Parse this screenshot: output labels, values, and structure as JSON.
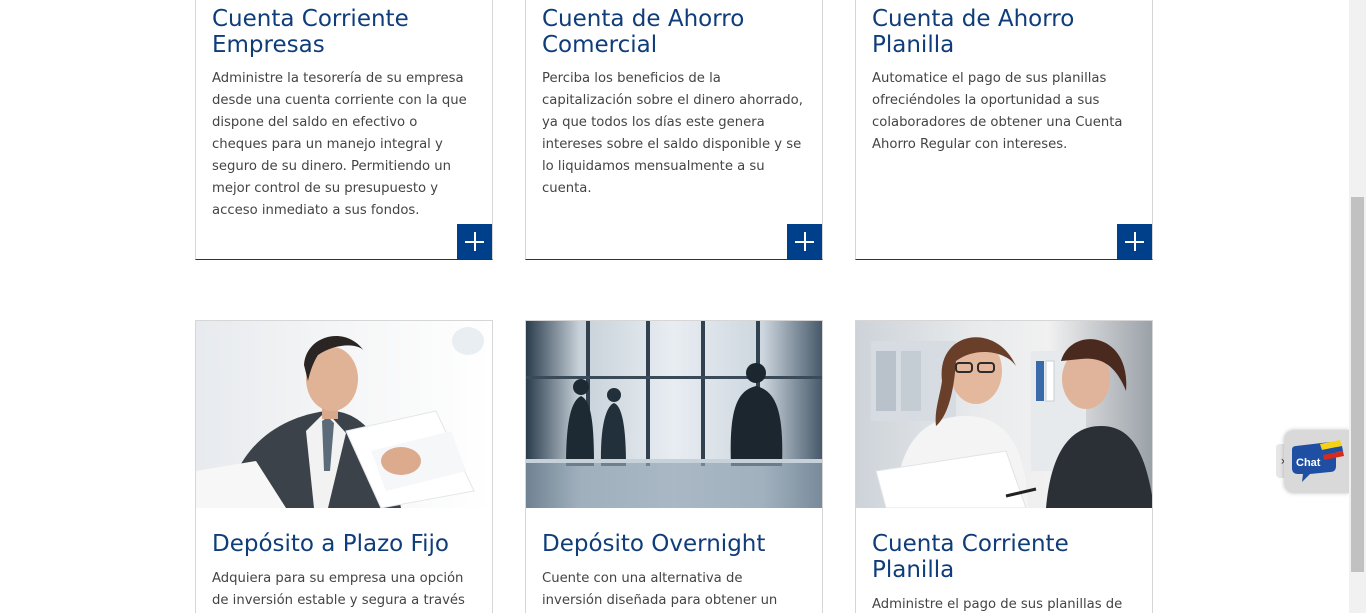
{
  "cards_top": [
    {
      "title": "Cuenta Corriente Empresas",
      "description": "Administre la tesorería de su empresa desde una cuenta corriente con la que dispone del saldo en efectivo o cheques para un manejo integral y seguro de su dinero. Permitiendo un mejor control de su presupuesto y acceso inmediato a sus fondos."
    },
    {
      "title": "Cuenta de Ahorro Comercial",
      "description": "Perciba los beneficios de la capitalización sobre el dinero ahorrado, ya que todos los días este genera intereses sobre el saldo disponible y se lo liquidamos mensualmente a su cuenta."
    },
    {
      "title": "Cuenta de Ahorro Planilla",
      "description": "Automatice el pago de sus planillas ofreciéndoles la oportunidad a sus colaboradores de obtener una Cuenta Ahorro Regular con intereses."
    }
  ],
  "cards_bottom": [
    {
      "title": "Depósito a Plazo Fijo",
      "description": "Adquiera para su empresa una opción de inversión estable y segura a través de un"
    },
    {
      "title": "Depósito Overnight",
      "description": "Cuente con una alternativa de inversión diseñada para obtener un retorno a corto"
    },
    {
      "title": "Cuenta Corriente Planilla",
      "description": "Administre el pago de sus planillas de"
    }
  ],
  "chat": {
    "label": "Chat",
    "tab_glyph": "›"
  },
  "colors": {
    "title_blue": "#0f3d7a",
    "button_blue": "#003f8a",
    "flag_yellow": "#f7d117",
    "flag_blue": "#1f4fa3",
    "flag_red": "#d52b1e"
  }
}
